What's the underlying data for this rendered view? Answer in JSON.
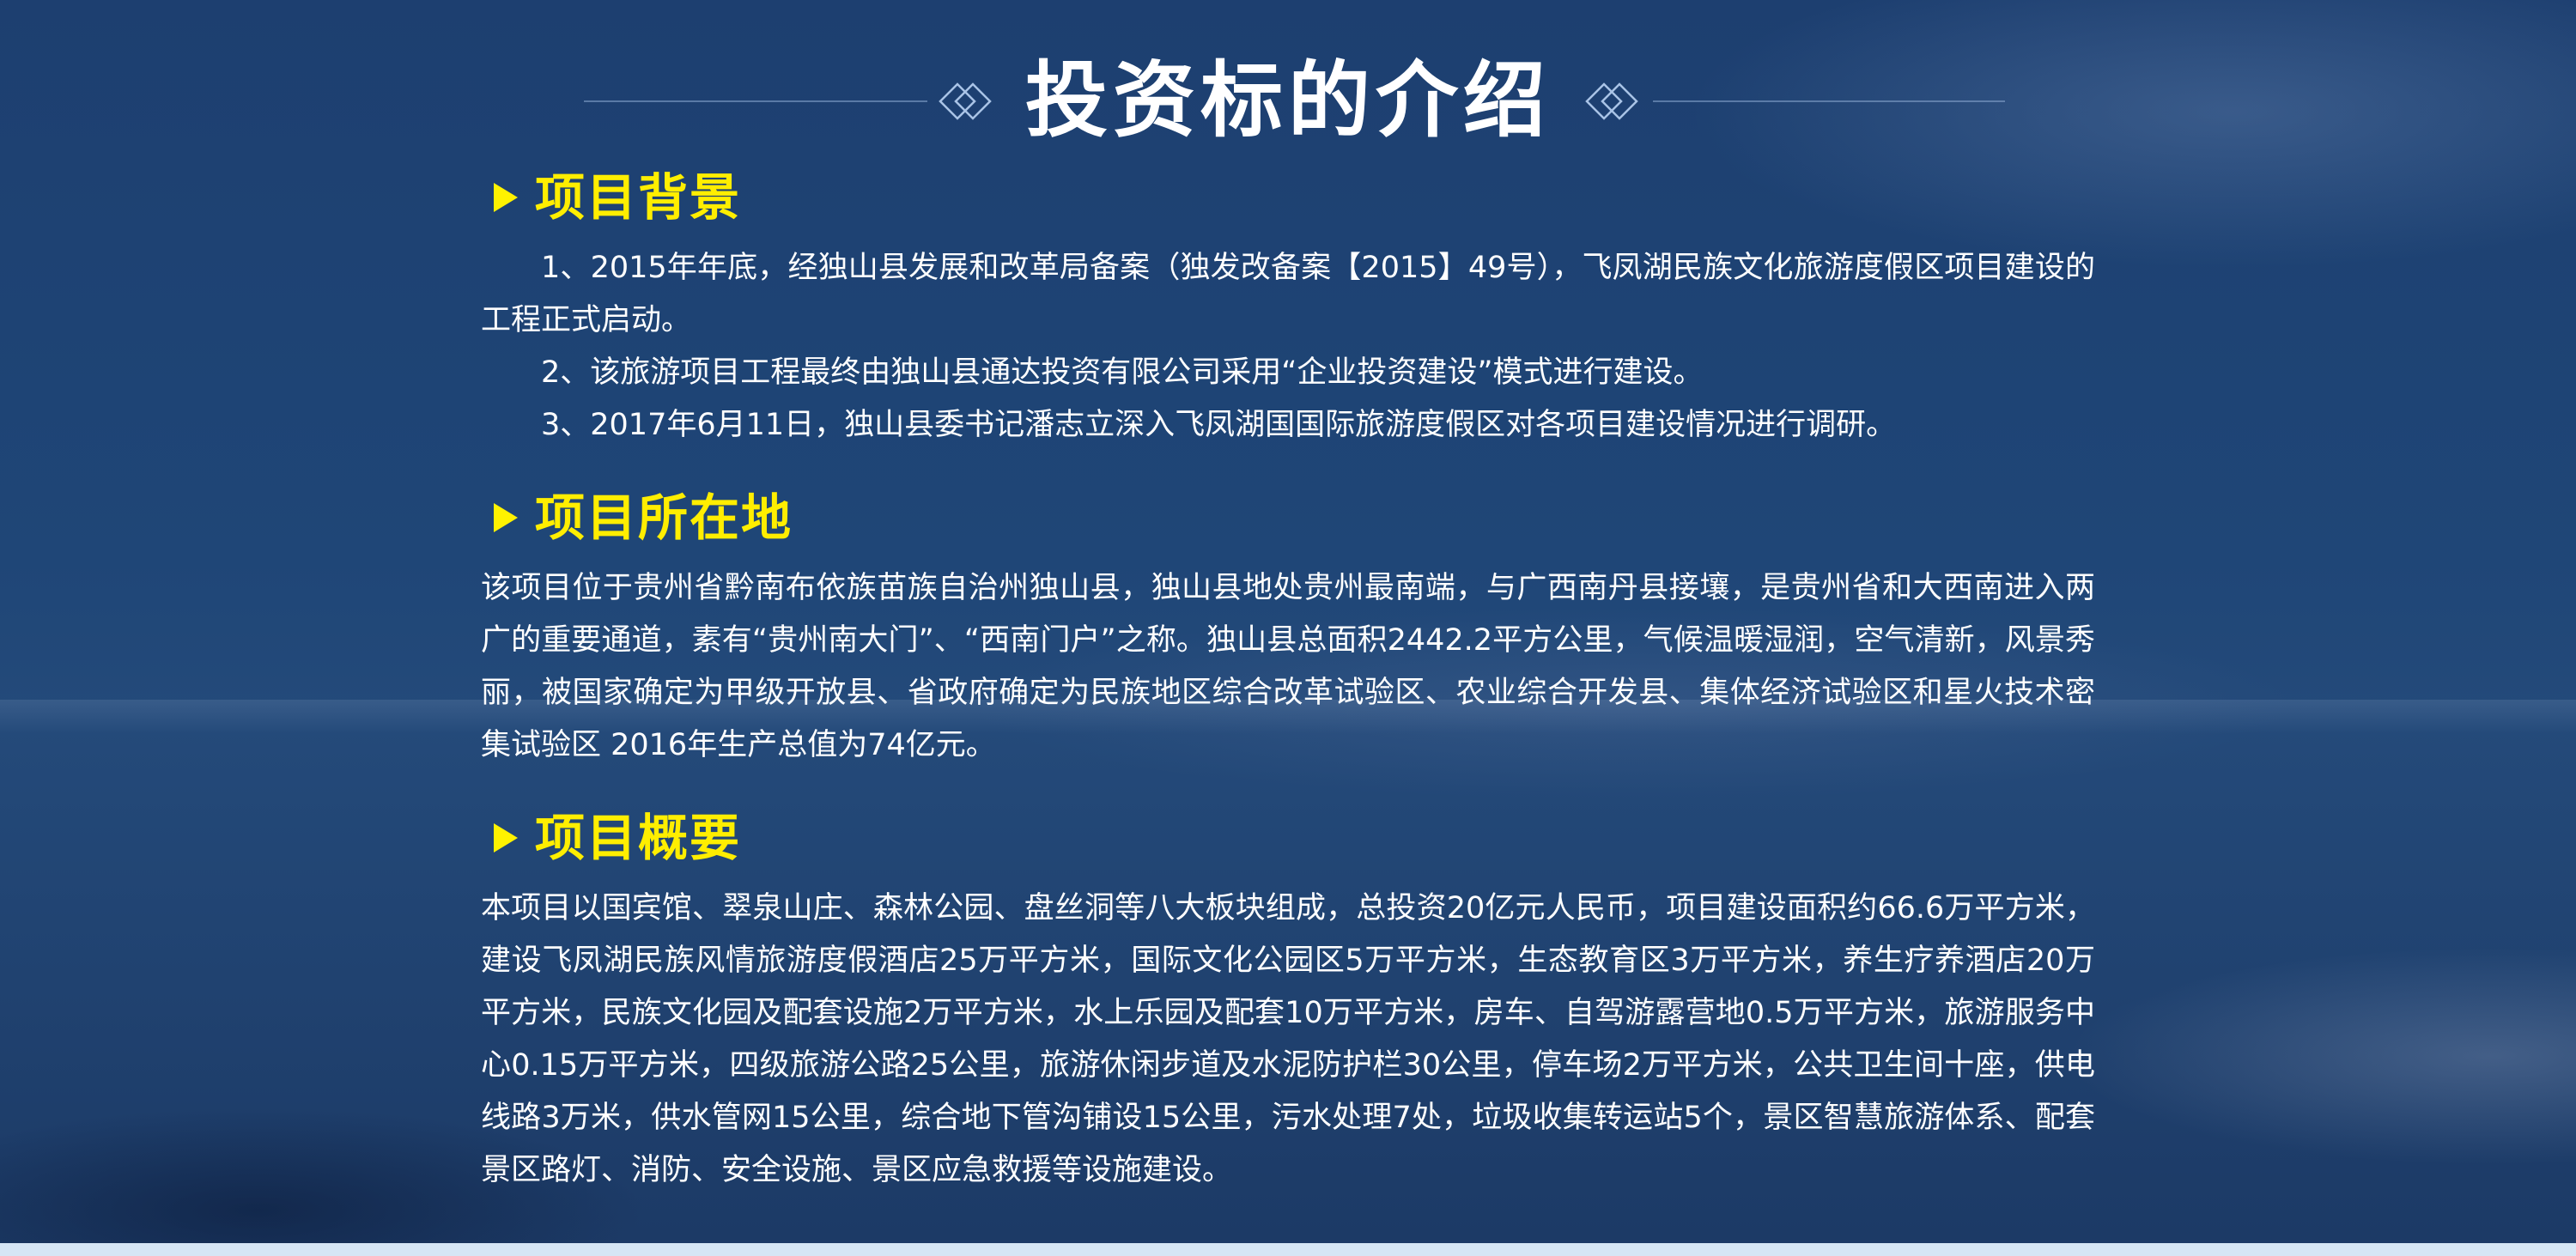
{
  "page": {
    "title": "投资标的介绍",
    "colors": {
      "background": "#1f4677",
      "title_text": "#ffffff",
      "section_heading": "#ffee00",
      "body_text": "#ffffff",
      "bottom_band": "#d6e6f5"
    }
  },
  "sections": [
    {
      "heading": "项目背景",
      "icon": "triangle-bullet-icon",
      "paragraphs": [
        "1、2015年年底，经独山县发展和改革局备案（独发改备案【2015】49号），飞凤湖民族文化旅游度假区项目建设的工程正式启动。",
        "2、该旅游项目工程最终由独山县通达投资有限公司采用“企业投资建设”模式进行建设。",
        "3、2017年6月11日，独山县委书记潘志立深入飞凤湖国国际旅游度假区对各项目建设情况进行调研。"
      ]
    },
    {
      "heading": "项目所在地",
      "icon": "triangle-bullet-icon",
      "paragraphs": [
        "该项目位于贵州省黔南布依族苗族自治州独山县，独山县地处贵州最南端，与广西南丹县接壤，是贵州省和大西南进入两广的重要通道，素有“贵州南大门”、“西南门户”之称。独山县总面积2442.2平方公里，气候温暖湿润，空气清新，风景秀丽，被国家确定为甲级开放县、省政府确定为民族地区综合改革试验区、农业综合开发县、集体经济试验区和星火技术密集试验区 2016年生产总值为74亿元。"
      ]
    },
    {
      "heading": "项目概要",
      "icon": "triangle-bullet-icon",
      "paragraphs": [
        "本项目以国宾馆、翠泉山庄、森林公园、盘丝洞等八大板块组成，总投资20亿元人民币，项目建设面积约66.6万平方米，建设飞凤湖民族风情旅游度假酒店25万平方米，国际文化公园区5万平方米，生态教育区3万平方米，养生疗养酒店20万平方米，民族文化园及配套设施2万平方米，水上乐园及配套10万平方米，房车、自驾游露营地0.5万平方米，旅游服务中心0.15万平方米，四级旅游公路25公里，旅游休闲步道及水泥防护栏30公里，停车场2万平方米，公共卫生间十座，供电线路3万米，供水管网15公里，综合地下管沟铺设15公里，污水处理7处，垃圾收集转运站5个，景区智慧旅游体系、配套景区路灯、消防、安全设施、景区应急救援等设施建设。"
      ]
    }
  ]
}
